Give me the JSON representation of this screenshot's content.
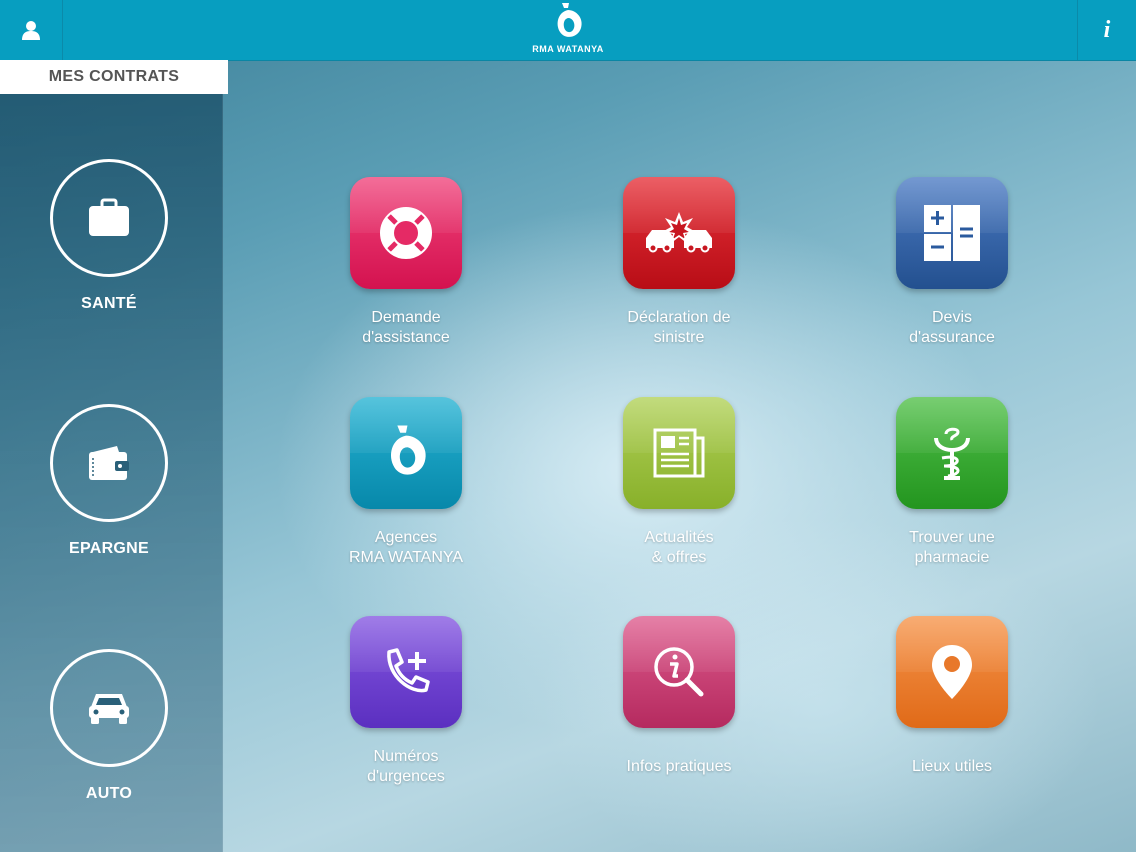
{
  "header": {
    "brand": "RMA WATANYA",
    "profile_icon": "user-icon",
    "info_icon": "info-icon",
    "info_glyph": "i",
    "bar_color": "#079ec0"
  },
  "sidebar": {
    "tab_label": "MES CONTRATS",
    "items": [
      {
        "label": "SANTÉ",
        "icon": "medical-bag-icon"
      },
      {
        "label": "EPARGNE",
        "icon": "wallet-icon"
      },
      {
        "label": "AUTO",
        "icon": "car-icon"
      }
    ]
  },
  "tiles": [
    {
      "line1": "Demande",
      "line2": "d'assistance",
      "icon": "lifebuoy-icon",
      "color": "#e31b5e"
    },
    {
      "line1": "Déclaration de",
      "line2": "sinistre",
      "icon": "car-crash-icon",
      "color": "#d0141c"
    },
    {
      "line1": "Devis",
      "line2": "d'assurance",
      "icon": "calculator-icon",
      "color": "#2f5ea8"
    },
    {
      "line1": "Agences",
      "line2": "RMA WATANYA",
      "icon": "rma-logo-icon",
      "color": "#0d95b8"
    },
    {
      "line1": "Actualités",
      "line2": "& offres",
      "icon": "newspaper-icon",
      "color": "#9cc23a"
    },
    {
      "line1": "Trouver une",
      "line2": "pharmacie",
      "icon": "pharmacy-icon",
      "color": "#34a832"
    },
    {
      "line1": "Numéros",
      "line2": "d'urgences",
      "icon": "emergency-phone-icon",
      "color": "#6a3fcf"
    },
    {
      "line1": "Infos pratiques",
      "line2": "",
      "icon": "info-search-icon",
      "color": "#c6376d"
    },
    {
      "line1": "Lieux utiles",
      "line2": "",
      "icon": "map-pin-icon",
      "color": "#ee7a22"
    }
  ]
}
